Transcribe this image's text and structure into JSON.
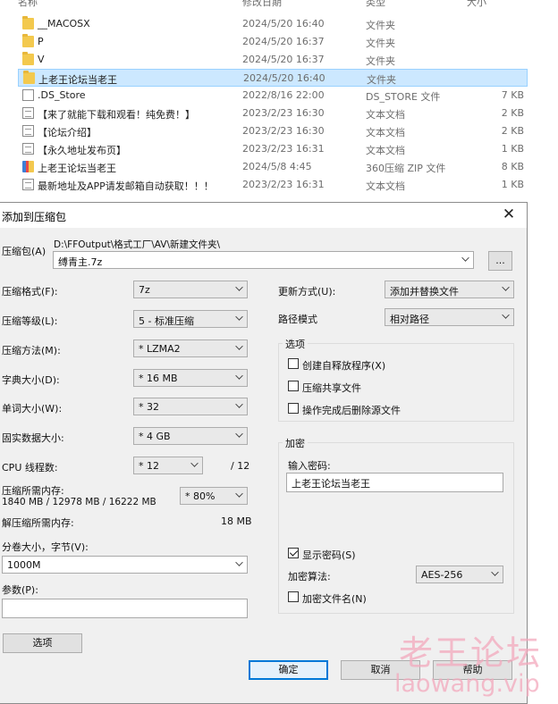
{
  "explorer": {
    "headers": {
      "name": "名称",
      "date": "修改日期",
      "type": "类型",
      "size": "大小"
    },
    "rows": [
      {
        "icon": "folder-icon",
        "name": "__MACOSX",
        "date": "2024/5/20 16:40",
        "type": "文件夹",
        "size": ""
      },
      {
        "icon": "folder-icon",
        "name": "P",
        "date": "2024/5/20 16:37",
        "type": "文件夹",
        "size": ""
      },
      {
        "icon": "folder-icon",
        "name": "V",
        "date": "2024/5/20 16:37",
        "type": "文件夹",
        "size": ""
      },
      {
        "icon": "folder-icon",
        "name": "上老王论坛当老王",
        "date": "2024/5/20 16:40",
        "type": "文件夹",
        "size": "",
        "selected": true
      },
      {
        "icon": "blank-file-icon",
        "name": ".DS_Store",
        "date": "2022/8/16 22:00",
        "type": "DS_STORE 文件",
        "size": "7 KB"
      },
      {
        "icon": "text-file-icon",
        "name": "【来了就能下载和观看！纯免费！】",
        "date": "2023/2/23 16:30",
        "type": "文本文档",
        "size": "2 KB"
      },
      {
        "icon": "text-file-icon",
        "name": "【论坛介绍】",
        "date": "2023/2/23 16:30",
        "type": "文本文档",
        "size": "2 KB"
      },
      {
        "icon": "text-file-icon",
        "name": "【永久地址发布页】",
        "date": "2023/2/23 16:31",
        "type": "文本文档",
        "size": "1 KB"
      },
      {
        "icon": "zip-file-icon",
        "name": "上老王论坛当老王",
        "date": "2024/5/8 4:45",
        "type": "360压缩 ZIP 文件",
        "size": "8 KB"
      },
      {
        "icon": "text-file-icon",
        "name": "最新地址及APP请发邮箱自动获取！！！",
        "date": "2023/2/23 16:31",
        "type": "文本文档",
        "size": "1 KB"
      }
    ]
  },
  "dialog": {
    "title": "添加到压缩包",
    "archive_label": "压缩包(A)",
    "archive_path": "D:\\FFOutput\\格式工厂\\AV\\新建文件夹\\",
    "archive_name": "缚青主.7z",
    "browse_label": "...",
    "left": {
      "format_label": "压缩格式(F):",
      "format_value": "7z",
      "level_label": "压缩等级(L):",
      "level_value": "5 - 标准压缩",
      "method_label": "压缩方法(M):",
      "method_value": "* LZMA2",
      "dict_label": "字典大小(D):",
      "dict_value": "* 16 MB",
      "word_label": "单词大小(W):",
      "word_value": "* 32",
      "solid_label": "固实数据大小:",
      "solid_value": "* 4 GB",
      "threads_label": "CPU 线程数:",
      "threads_value": "* 12",
      "threads_total": "/ 12",
      "mem_label": "压缩所需内存:",
      "mem_detail": "1840 MB / 12978 MB / 16222 MB",
      "mem_value": "* 80%",
      "decomp_label": "解压缩所需内存:",
      "decomp_value": "18 MB",
      "volume_label": "分卷大小，字节(V):",
      "volume_value": "1000M",
      "params_label": "参数(P):",
      "params_value": "",
      "options_button": "选项"
    },
    "right": {
      "update_label": "更新方式(U):",
      "update_value": "添加并替换文件",
      "pathmode_label": "路径模式",
      "pathmode_value": "相对路径",
      "options_group": "选项",
      "opt_sfx": "创建自释放程序(X)",
      "opt_shared": "压缩共享文件",
      "opt_delete": "操作完成后删除源文件",
      "encrypt_group": "加密",
      "password_label": "输入密码:",
      "password_value": "上老王论坛当老王",
      "show_password": "显示密码(S)",
      "enc_method_label": "加密算法:",
      "enc_method_value": "AES-256",
      "encrypt_names": "加密文件名(N)"
    },
    "buttons": {
      "ok": "确定",
      "cancel": "取消",
      "help": "帮助"
    }
  },
  "watermark": {
    "line1": "老王论坛",
    "line2": "laowang.vip",
    "color": "#f3a9bd"
  }
}
